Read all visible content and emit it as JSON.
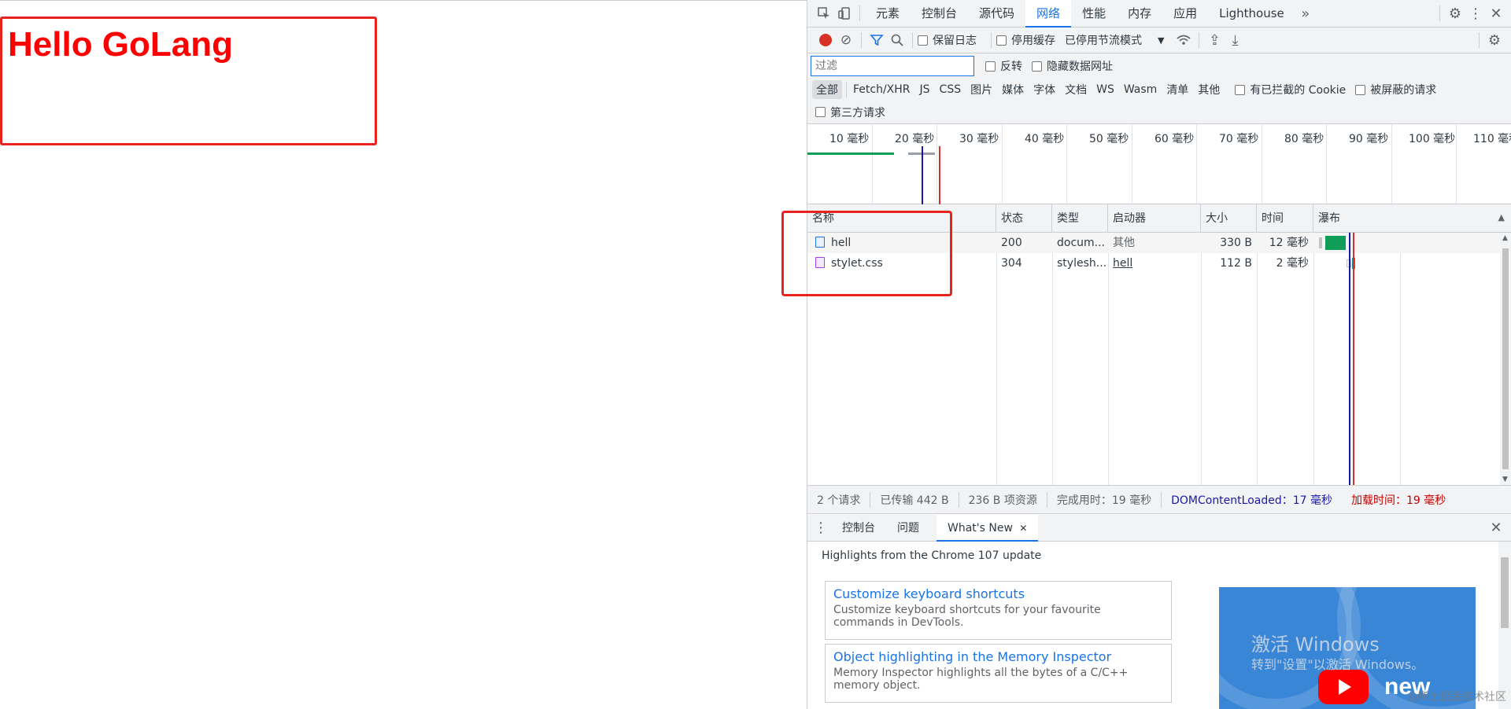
{
  "page": {
    "heading": "Hello GoLang"
  },
  "devtools": {
    "tabs": [
      "元素",
      "控制台",
      "源代码",
      "网络",
      "性能",
      "内存",
      "应用",
      "Lighthouse"
    ],
    "active_tab": "网络",
    "more_tabs": "»",
    "toolbar": {
      "preserve_log": "保留日志",
      "disable_cache": "停用缓存",
      "throttling": "已停用节流模式"
    },
    "filter": {
      "placeholder": "过滤",
      "invert": "反转",
      "hide_data_urls": "隐藏数据网址"
    },
    "type_filters": [
      "全部",
      "Fetch/XHR",
      "JS",
      "CSS",
      "图片",
      "媒体",
      "字体",
      "文档",
      "WS",
      "Wasm",
      "清单",
      "其他"
    ],
    "blocked_cookies": "有已拦截的 Cookie",
    "blocked_requests": "被屏蔽的请求",
    "third_party": "第三方请求",
    "overview_ticks": [
      "10 毫秒",
      "20 毫秒",
      "30 毫秒",
      "40 毫秒",
      "50 毫秒",
      "60 毫秒",
      "70 毫秒",
      "80 毫秒",
      "90 毫秒",
      "100 毫秒",
      "110 毫秒"
    ],
    "columns": [
      "名称",
      "状态",
      "类型",
      "启动器",
      "大小",
      "时间",
      "瀑布"
    ],
    "rows": [
      {
        "name": "hell",
        "status": "200",
        "type": "docum...",
        "initiator": "其他",
        "size": "330 B",
        "time": "12 毫秒"
      },
      {
        "name": "stylet.css",
        "status": "304",
        "type": "stylesh...",
        "initiator": "hell",
        "size": "112 B",
        "time": "2 毫秒"
      }
    ],
    "status_bar": {
      "requests": "2 个请求",
      "transferred": "已传输 442 B",
      "resources": "236 B 项资源",
      "finish": "完成用时：19 毫秒",
      "dom_content_loaded": "DOMContentLoaded：17 毫秒",
      "load": "加载时间：19 毫秒"
    },
    "drawer": {
      "tabs": [
        "控制台",
        "问题",
        "What's New"
      ],
      "active_tab": "What's New",
      "highlights": "Highlights from the Chrome 107 update",
      "cards": [
        {
          "title": "Customize keyboard shortcuts",
          "desc": "Customize keyboard shortcuts for your favourite commands in DevTools."
        },
        {
          "title": "Object highlighting in the Memory Inspector",
          "desc": "Memory Inspector highlights all the bytes of a C/C++ memory object."
        }
      ],
      "promo_text": "new"
    }
  },
  "watermarks": {
    "activate_title": "激活 Windows",
    "activate_sub": "转到\"设置\"以激活 Windows。",
    "site": "@稀土掘金技术社区"
  },
  "colors": {
    "accent": "#1a73e8",
    "annotation": "#e8231e",
    "heading": "#ff0000"
  }
}
